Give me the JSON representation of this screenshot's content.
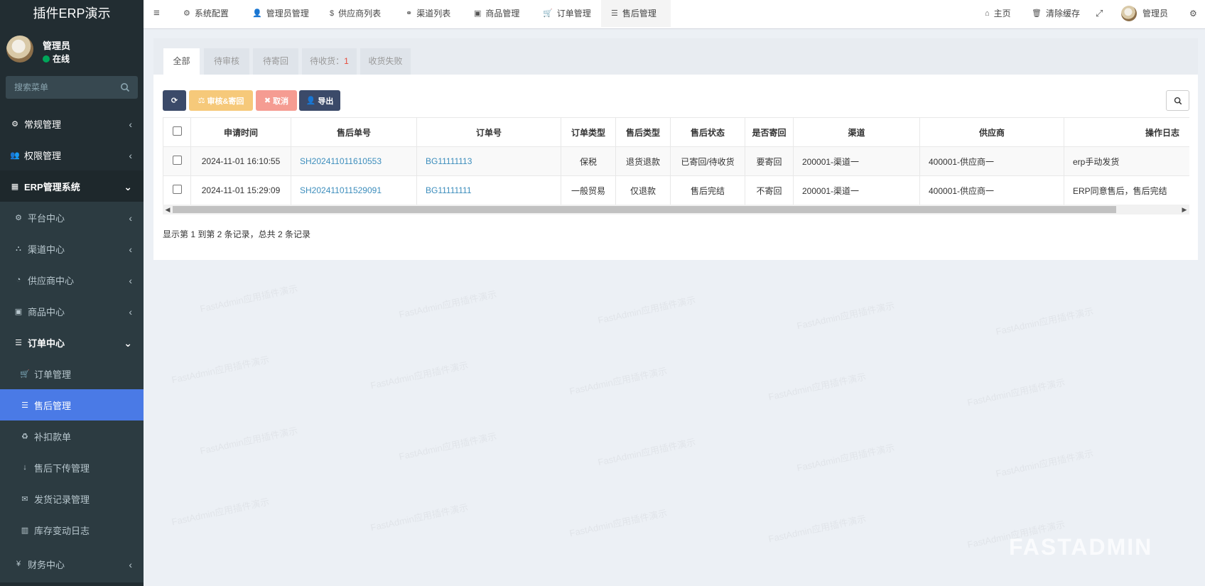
{
  "sidebar": {
    "brand": "插件ERP演示",
    "user": {
      "name": "管理员",
      "status": "在线"
    },
    "search_placeholder": "搜索菜单",
    "menu": [
      {
        "label": "常规管理",
        "icon": "cogs-icon"
      },
      {
        "label": "权限管理",
        "icon": "users-icon"
      },
      {
        "label": "ERP管理系统",
        "icon": "table-icon"
      },
      {
        "label": "平台中心",
        "icon": "gear-icon"
      },
      {
        "label": "渠道中心",
        "icon": "sitemap-icon"
      },
      {
        "label": "供应商中心",
        "icon": "dashboard-icon"
      },
      {
        "label": "商品中心",
        "icon": "briefcase-icon"
      },
      {
        "label": "订单中心",
        "icon": "list-icon"
      },
      {
        "label": "订单管理",
        "icon": "cart-icon"
      },
      {
        "label": "售后管理",
        "icon": "list-icon"
      },
      {
        "label": "补扣款单",
        "icon": "recycle-icon"
      },
      {
        "label": "售后下传管理",
        "icon": "arrow-down-icon"
      },
      {
        "label": "发货记录管理",
        "icon": "envelope-icon"
      },
      {
        "label": "库存变动日志",
        "icon": "bar-chart-icon"
      },
      {
        "label": "财务中心",
        "icon": "yen-icon"
      }
    ]
  },
  "topbar": {
    "tabs": [
      {
        "label": "系统配置",
        "icon": "gear-icon"
      },
      {
        "label": "管理员管理",
        "icon": "user-icon"
      },
      {
        "label": "供应商列表",
        "icon": "dollar-icon"
      },
      {
        "label": "渠道列表",
        "icon": "link-icon"
      },
      {
        "label": "商品管理",
        "icon": "briefcase-icon"
      },
      {
        "label": "订单管理",
        "icon": "cart-icon"
      },
      {
        "label": "售后管理",
        "icon": "list-icon"
      }
    ],
    "home": "主页",
    "clear_cache": "清除缓存",
    "admin": "管理员"
  },
  "content": {
    "status_tabs": [
      {
        "label": "全部"
      },
      {
        "label": "待审核"
      },
      {
        "label": "待寄回"
      },
      {
        "label": "待收货：",
        "count": "1"
      },
      {
        "label": "收货失败"
      }
    ],
    "toolbar": {
      "audit": "审核&寄回",
      "cancel": "取消",
      "export": "导出"
    },
    "table": {
      "columns": [
        "申请时间",
        "售后单号",
        "订单号",
        "订单类型",
        "售后类型",
        "售后状态",
        "是否寄回",
        "渠道",
        "供应商",
        "操作日志"
      ],
      "rows": [
        [
          "2024-11-01 16:10:55",
          "SH202411011610553",
          "BG11111113",
          "保税",
          "退货退款",
          "已寄回/待收货",
          "要寄回",
          "200001-渠道一",
          "400001-供应商一",
          "erp手动发货"
        ],
        [
          "2024-11-01 15:29:09",
          "SH202411011529091",
          "BG11111111",
          "一般贸易",
          "仅退款",
          "售后完结",
          "不寄回",
          "200001-渠道一",
          "400001-供应商一",
          "ERP同意售后，售后完结"
        ]
      ]
    },
    "pagination_info": "显示第 1 到第 2 条记录，总共 2 条记录"
  },
  "watermark_text": "FastAdmin应用插件演示",
  "logo_text": "FASTADMIN",
  "colors": {
    "sidebar": "#222d32",
    "active": "#4a7ae6",
    "link": "#3c8dbc"
  }
}
